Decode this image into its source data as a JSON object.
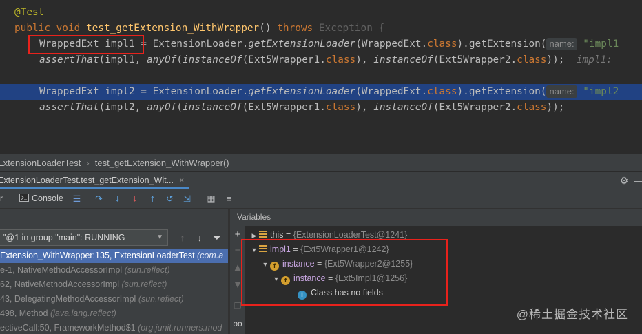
{
  "editor": {
    "annotation": "@Test",
    "method_line": {
      "modifiers": "public void ",
      "name": "test_getExtension_WithWrapper",
      "params": "() ",
      "throws": "throws ",
      "exception": "Exception {"
    },
    "line3": {
      "type": "WrappedExt",
      "var": "impl1",
      "rest_a": " = ExtensionLoader.",
      "call1": "getExtensionLoader",
      "rest_b": "(WrappedExt.",
      "kw_class": "class",
      "rest_c": ").getExtension(",
      "hint": "name:",
      "str": " \"impl1"
    },
    "line4": {
      "call": "assertThat",
      "a": "(impl1, ",
      "anyOf": "anyOf",
      "b": "(",
      "inst1": "instanceOf",
      "c": "(Ext5Wrapper1.",
      "cls1": "class",
      "d": "), ",
      "inst2": "instanceOf",
      "e": "(Ext5Wrapper2.",
      "cls2": "class",
      "f": "));",
      "ghost": "  impl1: "
    },
    "line6": {
      "type": "WrappedExt",
      "var": "impl2",
      "rest_a": " = ExtensionLoader.",
      "call1": "getExtensionLoader",
      "rest_b": "(WrappedExt.",
      "kw_class": "class",
      "rest_c": ").getExtension(",
      "hint": "name:",
      "str": " \"impl2"
    },
    "line7": {
      "call": "assertThat",
      "a": "(impl2, ",
      "anyOf": "anyOf",
      "b": "(",
      "inst1": "instanceOf",
      "c": "(Ext5Wrapper1.",
      "cls1": "class",
      "d": "), ",
      "inst2": "instanceOf",
      "e": "(Ext5Wrapper2.",
      "cls2": "class",
      "f": "));"
    }
  },
  "breadcrumb": {
    "class": "ExtensionLoaderTest",
    "method": "test_getExtension_WithWrapper()"
  },
  "session": {
    "tab_label": "ExtensionLoaderTest.test_getExtension_Wit...",
    "close": "×"
  },
  "toolbar": {
    "console_label": "Console",
    "left_fragment": "r"
  },
  "frames": {
    "thread": "\"@1 in group \"main\": RUNNING",
    "items": [
      {
        "text": "Extension_WithWrapper:135, ExtensionLoaderTest ",
        "cls": "(com.a"
      },
      {
        "text": "e-1, NativeMethodAccessorImpl ",
        "cls": "(sun.reflect)"
      },
      {
        "text": "62, NativeMethodAccessorImpl ",
        "cls": "(sun.reflect)"
      },
      {
        "text": "43, DelegatingMethodAccessorImpl ",
        "cls": "(sun.reflect)"
      },
      {
        "text": "498, Method ",
        "cls": "(java.lang.reflect)"
      },
      {
        "text": "ectiveCall:50, FrameworkMethod$1 ",
        "cls": "(org.junit.runners.mod"
      }
    ]
  },
  "variables": {
    "title": "Variables",
    "rows": {
      "this": {
        "name": "this",
        "eq": " = ",
        "value": "{ExtensionLoaderTest@1241}"
      },
      "impl1": {
        "name": "impl1",
        "eq": " = ",
        "value": "{Ext5Wrapper1@1242}"
      },
      "instance1": {
        "name": "instance",
        "eq": " = ",
        "value": "{Ext5Wrapper2@1255}"
      },
      "instance2": {
        "name": "instance",
        "eq": " = ",
        "value": "{Ext5Impl1@1256}"
      },
      "nofields": {
        "text": "Class has no fields"
      }
    }
  },
  "watermark": "@稀土掘金技术社区",
  "colors": {
    "highlight": "#214283",
    "selection": "#4b6eaf",
    "red_box": "#e8221c",
    "keyword": "#cc7832",
    "method": "#ffc66d"
  }
}
